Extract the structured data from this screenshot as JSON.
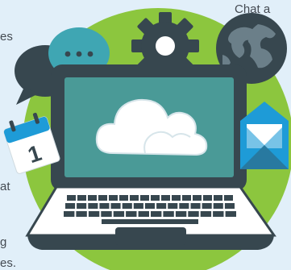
{
  "illustration": {
    "text_fragments": {
      "top_right": "Chat a",
      "left_upper": "es",
      "left_middle": "at",
      "left_lower": "g",
      "left_bottom": "es."
    },
    "calendar_day": "1",
    "icons": [
      "chat-bubble-icon",
      "chat-typing-icon",
      "gear-icon",
      "globe-icon",
      "calendar-icon",
      "envelope-icon",
      "cloud-icon",
      "laptop-icon"
    ],
    "colors": {
      "background": "#e1eff9",
      "circle": "#8cc63e",
      "dark": "#37474f",
      "teal": "#3fa6b3",
      "screen": "#4a9a97",
      "cloud": "#ffffff",
      "blue": "#1e9bd7"
    }
  }
}
